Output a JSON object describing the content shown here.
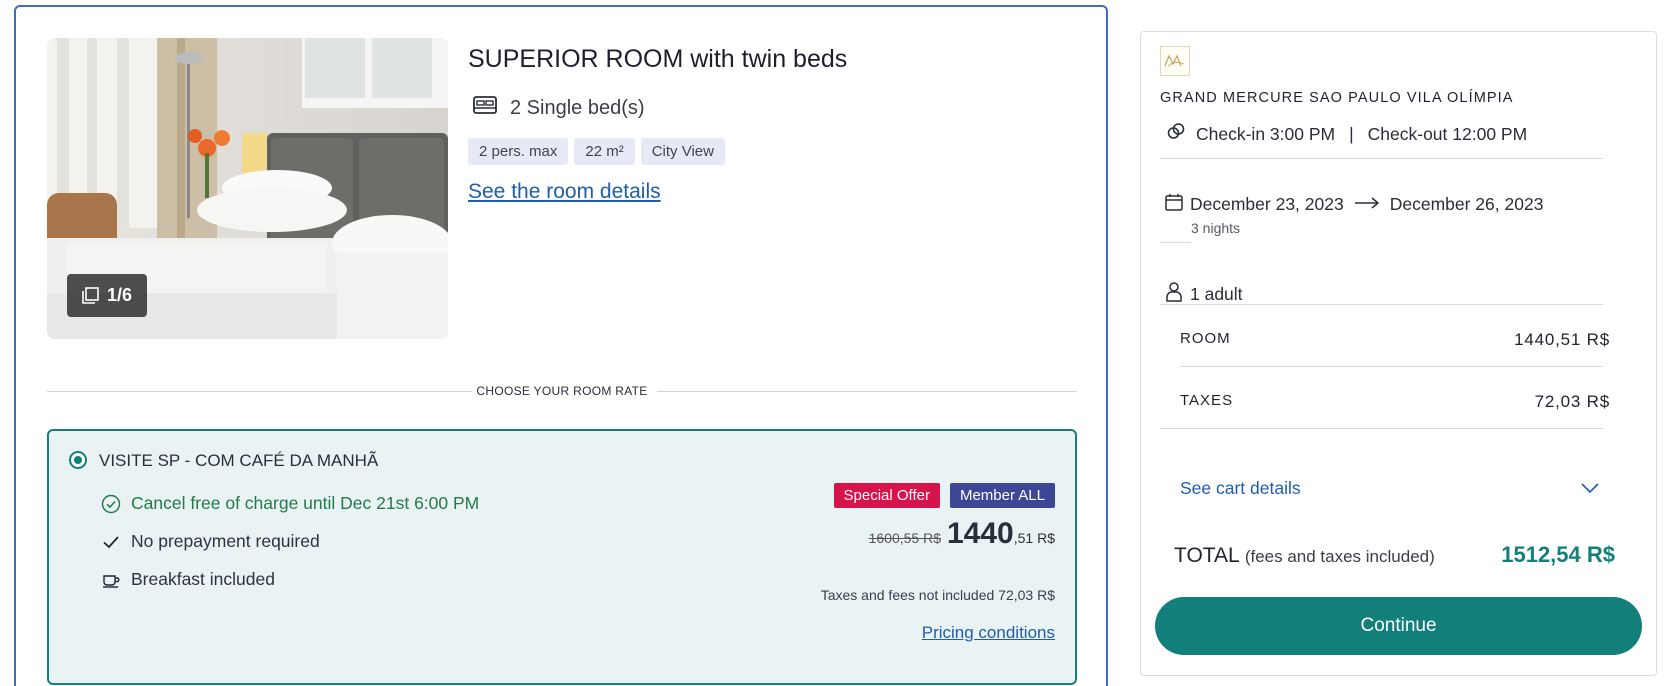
{
  "room": {
    "title": "SUPERIOR ROOM with twin beds",
    "beds": "2 Single bed(s)",
    "tags": [
      "2 pers. max",
      "22 m²",
      "City View"
    ],
    "details_link": "See the room details",
    "photo_counter": "1/6"
  },
  "rate": {
    "section_label": "CHOOSE YOUR ROOM RATE",
    "name": "VISITE SP - COM CAFÉ DA MANHÃ",
    "benefits": [
      {
        "icon": "check-circle-icon",
        "text": "Cancel free of charge until Dec 21st 6:00 PM"
      },
      {
        "icon": "check-icon",
        "text": "No prepayment required"
      },
      {
        "icon": "coffee-cup-icon",
        "text": "Breakfast included"
      }
    ],
    "badges": {
      "offer": "Special Offer",
      "member": "Member ALL"
    },
    "old_price": "1600,55 R$",
    "price_int": "1440",
    "price_dec": ",51 R$",
    "taxes_note": "Taxes and fees not included 72,03 R$",
    "pricing_link": "Pricing conditions"
  },
  "summary": {
    "hotel_name": "GRAND MERCURE SAO PAULO VILA OLÍMPIA",
    "checkin": "Check-in 3:00 PM",
    "checkin_sep": "|",
    "checkout": "Check-out 12:00 PM",
    "date_from": "December 23, 2023",
    "date_to": "December 26, 2023",
    "nights": "3 nights",
    "guests": "1 adult",
    "room_label": "ROOM",
    "room_amount": "1440,51 R$",
    "taxes_label": "TAXES",
    "taxes_amount": "72,03 R$",
    "cart_link": "See cart details",
    "total_label": "TOTAL",
    "total_note": "(fees and taxes included)",
    "total_amount": "1512,54 R$",
    "continue": "Continue"
  },
  "colors": {
    "accent": "#137f7b",
    "link": "#1f5ea8",
    "offer": "#d6134b",
    "member": "#3d4795",
    "card_border": "#3f6cc2"
  }
}
